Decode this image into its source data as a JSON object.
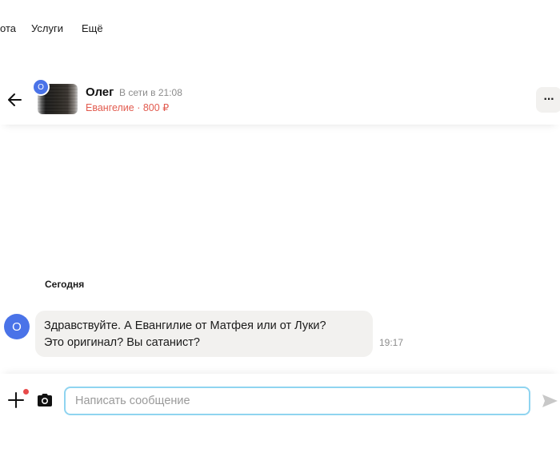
{
  "topnav": {
    "items": [
      "ота",
      "Услуги",
      "Ещё"
    ]
  },
  "chat_header": {
    "avatar_letter": "О",
    "user_name": "Олег",
    "user_status": "В сети в 21:08",
    "listing_title": "Евангелие",
    "listing_separator": " · ",
    "listing_price": "800 ₽",
    "more_label": "···"
  },
  "messages": {
    "date_separator": "Сегодня",
    "items": [
      {
        "avatar_letter": "О",
        "line1": "Здравствуйте. А Евангилие от Матфея или от Луки?",
        "line2": "Это оригинал? Вы сатанист?",
        "time": "19:17"
      }
    ]
  },
  "composer": {
    "placeholder": "Написать сообщение",
    "value": ""
  },
  "colors": {
    "avatar": "#4a73e8",
    "listing": "#e25b4f",
    "input_border": "#8fd4f0",
    "bubble_bg": "#f2f1ef"
  },
  "icons": [
    "arrow-left-icon",
    "more-icon",
    "plus-icon",
    "camera-icon",
    "send-icon"
  ]
}
